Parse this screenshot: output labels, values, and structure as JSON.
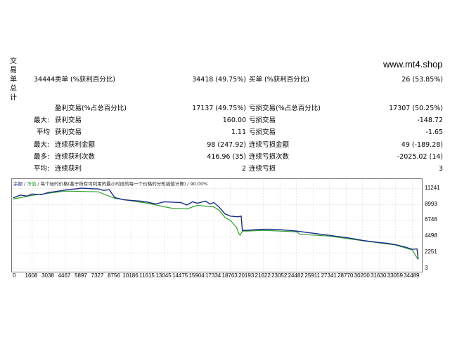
{
  "brand": "www.mt4.shop",
  "side_label": [
    "交",
    "易",
    "单",
    "总",
    "计"
  ],
  "rows": [
    {
      "c1": "34444",
      "c2": "卖单 (%获利百分比)",
      "c3": "34418 (49.75%)",
      "c4": "买单 (%获利百分比)",
      "c5": "26 (53.85%)"
    },
    {
      "c1": "",
      "c2": "盈利交易(%占总百分比)",
      "c3": "17137 (49.75%)",
      "c4": "亏损交易(%占总百分比)",
      "c5": "17307 (50.25%)"
    },
    {
      "c1": "最大:",
      "c2": "获利交易",
      "c3": "160.00",
      "c4": "亏损交易",
      "c5": "-148.72"
    },
    {
      "c1": "平均",
      "c2": "获利交易",
      "c3": "1.11",
      "c4": "亏损交易",
      "c5": "-1.65"
    },
    {
      "c1": "最大:",
      "c2": "连续获利金额",
      "c3": "98 (247.92)",
      "c4": "连续亏损金额",
      "c5": "49 (-189.28)"
    },
    {
      "c1": "最多:",
      "c2": "连续获利次数",
      "c3": "416.96 (35)",
      "c4": "连续亏损次数",
      "c5": "-2025.02 (14)"
    },
    {
      "c1": "平均:",
      "c2": "连续获利",
      "c3": "2",
      "c4": "连续亏损",
      "c5": "3"
    }
  ],
  "chart_data": {
    "type": "line",
    "legend": {
      "balance": "余额",
      "equity": "净值",
      "model": "每个标时价格(基于所有可利用的最小时段的每一个价格的分形插值计算)",
      "quality": "90.00%"
    },
    "colors": {
      "balance": "#1a2a8a",
      "equity": "#2ca02c"
    },
    "ylim": [
      3,
      12000
    ],
    "yticks": [
      "11241",
      "8993",
      "6746",
      "4498",
      "2251",
      "3"
    ],
    "ytick_values": [
      11241,
      8993,
      6746,
      4498,
      2251,
      3
    ],
    "xticks": [
      "0",
      "1608",
      "3038",
      "4467",
      "5897",
      "7327",
      "8756",
      "10186",
      "11615",
      "13045",
      "14475",
      "15904",
      "17334",
      "18763",
      "20193",
      "21622",
      "23052",
      "24482",
      "25911",
      "27341",
      "28770",
      "30200",
      "31630",
      "33059",
      "34489"
    ],
    "xlim": [
      0,
      35200
    ],
    "balance": [
      [
        0,
        9950
      ],
      [
        600,
        10350
      ],
      [
        1200,
        10200
      ],
      [
        1608,
        10500
      ],
      [
        2400,
        10400
      ],
      [
        3038,
        10700
      ],
      [
        3700,
        10850
      ],
      [
        4467,
        11050
      ],
      [
        5100,
        11150
      ],
      [
        5897,
        11300
      ],
      [
        6500,
        11250
      ],
      [
        7327,
        11200
      ],
      [
        7800,
        11000
      ],
      [
        8300,
        11100
      ],
      [
        8756,
        10000
      ],
      [
        9500,
        9700
      ],
      [
        10186,
        9600
      ],
      [
        11000,
        9500
      ],
      [
        11615,
        9350
      ],
      [
        12300,
        9100
      ],
      [
        13045,
        9400
      ],
      [
        13700,
        9350
      ],
      [
        14475,
        9300
      ],
      [
        15000,
        8950
      ],
      [
        15500,
        9400
      ],
      [
        15904,
        9200
      ],
      [
        16600,
        9500
      ],
      [
        17000,
        9100
      ],
      [
        17334,
        9300
      ],
      [
        17800,
        8650
      ],
      [
        18300,
        7700
      ],
      [
        18763,
        7400
      ],
      [
        19400,
        7300
      ],
      [
        19700,
        7400
      ],
      [
        19800,
        5400
      ],
      [
        20193,
        5400
      ],
      [
        20900,
        5500
      ],
      [
        21622,
        5550
      ],
      [
        22300,
        5550
      ],
      [
        23052,
        5500
      ],
      [
        23700,
        5400
      ],
      [
        24482,
        5300
      ],
      [
        25200,
        5150
      ],
      [
        25911,
        5000
      ],
      [
        26600,
        4850
      ],
      [
        27341,
        4700
      ],
      [
        28000,
        4550
      ],
      [
        28770,
        4400
      ],
      [
        29500,
        4200
      ],
      [
        30200,
        4000
      ],
      [
        30900,
        3850
      ],
      [
        31630,
        3700
      ],
      [
        32300,
        3600
      ],
      [
        33059,
        3400
      ],
      [
        33800,
        3100
      ],
      [
        34489,
        2750
      ],
      [
        34900,
        2800
      ],
      [
        35000,
        1400
      ]
    ],
    "equity": [
      [
        0,
        9800
      ],
      [
        1608,
        10300
      ],
      [
        4467,
        10900
      ],
      [
        7327,
        10800
      ],
      [
        8756,
        9900
      ],
      [
        11615,
        9200
      ],
      [
        13700,
        8500
      ],
      [
        15000,
        8400
      ],
      [
        15904,
        8900
      ],
      [
        17334,
        8700
      ],
      [
        17800,
        8200
      ],
      [
        18300,
        7200
      ],
      [
        18763,
        6800
      ],
      [
        19300,
        5800
      ],
      [
        19500,
        4900
      ],
      [
        19600,
        4700
      ],
      [
        19800,
        5300
      ],
      [
        20193,
        5300
      ],
      [
        21622,
        5400
      ],
      [
        24482,
        5200
      ],
      [
        24800,
        4850
      ],
      [
        27341,
        4600
      ],
      [
        30200,
        3950
      ],
      [
        33059,
        3350
      ],
      [
        34489,
        2650
      ],
      [
        35000,
        1300
      ]
    ]
  }
}
